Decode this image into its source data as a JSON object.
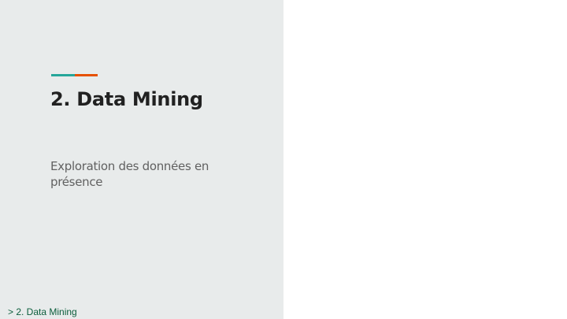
{
  "slide": {
    "title": "2. Data Mining",
    "subtitle": "Exploration des données en présence",
    "footer_breadcrumb": "> 2. Data Mining"
  },
  "colors": {
    "left_panel_bg": "#e8ebeb",
    "accent_teal": "#26a69a",
    "accent_orange": "#e65100",
    "title_text": "#212121",
    "subtitle_text": "#616161",
    "footer_text": "#0b5d3b"
  }
}
